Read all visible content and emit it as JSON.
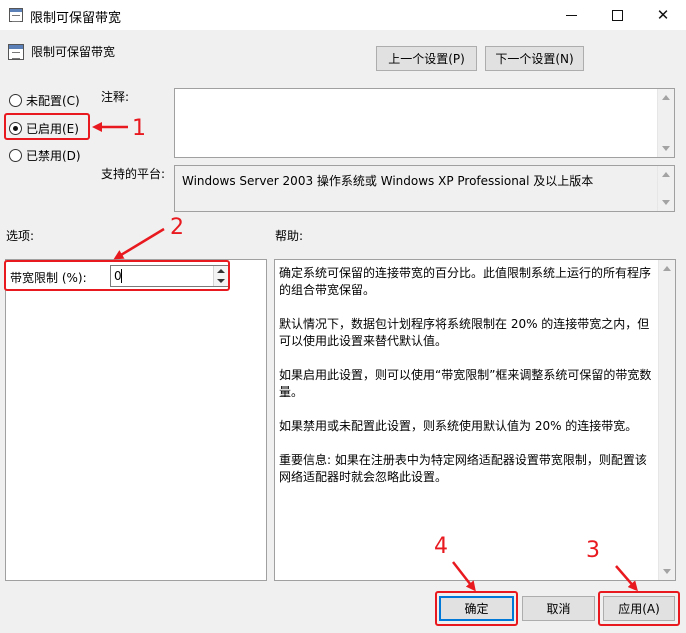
{
  "window": {
    "title": "限制可保留带宽",
    "min_icon": "minimize-icon",
    "max_icon": "maximize-icon",
    "close_icon": "close-icon",
    "close_glyph": "✕"
  },
  "header": {
    "title": "限制可保留带宽",
    "prev_button": "上一个设置(P)",
    "next_button": "下一个设置(N)"
  },
  "state": {
    "options": [
      {
        "label": "未配置(C)",
        "selected": false
      },
      {
        "label": "已启用(E)",
        "selected": true
      },
      {
        "label": "已禁用(D)",
        "selected": false
      }
    ]
  },
  "comment": {
    "label": "注释:",
    "value": ""
  },
  "platform": {
    "label": "支持的平台:",
    "value": "Windows Server 2003 操作系统或 Windows XP Professional 及以上版本"
  },
  "options_section": {
    "label": "选项:",
    "field_label": "带宽限制 (%):",
    "field_value": "0"
  },
  "help_section": {
    "label": "帮助:",
    "paragraphs": [
      "确定系统可保留的连接带宽的百分比。此值限制系统上运行的所有程序的组合带宽保留。",
      "默认情况下，数据包计划程序将系统限制在 20% 的连接带宽之内，但可以使用此设置来替代默认值。",
      "如果启用此设置，则可以使用“带宽限制”框来调整系统可保留的带宽数量。",
      "如果禁用或未配置此设置，则系统使用默认值为 20% 的连接带宽。",
      "重要信息: 如果在注册表中为特定网络适配器设置带宽限制，则配置该网络适配器时就会忽略此设置。"
    ]
  },
  "footer": {
    "ok": "确定",
    "cancel": "取消",
    "apply": "应用(A)"
  },
  "annotations": {
    "color": "#e8191f",
    "labels": [
      "1",
      "2",
      "3",
      "4"
    ]
  }
}
